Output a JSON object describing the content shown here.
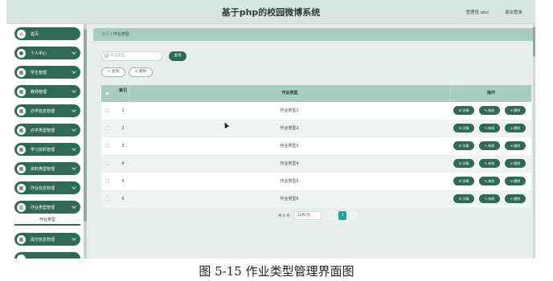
{
  "header": {
    "title": "基于php的校园微博系统",
    "user": "管理员 abo",
    "logout": "退出登录"
  },
  "sidebar": {
    "items": [
      {
        "label": "首页",
        "icon": "home-icon",
        "glyph": "⌂"
      },
      {
        "label": "个人中心",
        "icon": "person-icon",
        "glyph": "●"
      },
      {
        "label": "学生管理",
        "icon": "grid-icon",
        "glyph": "▦"
      },
      {
        "label": "教师管理",
        "icon": "grid-icon",
        "glyph": "▦"
      },
      {
        "label": "办学信息管理",
        "icon": "grid-icon",
        "glyph": "▦"
      },
      {
        "label": "办学类型管理",
        "icon": "grid-icon",
        "glyph": "▦"
      },
      {
        "label": "学习资料管理",
        "icon": "grid-icon",
        "glyph": "▦"
      },
      {
        "label": "资料类型管理",
        "icon": "grid-icon",
        "glyph": "▦"
      },
      {
        "label": "作业信息管理",
        "icon": "grid-icon",
        "glyph": "▦"
      },
      {
        "label": "作业类型管理",
        "icon": "chart-icon",
        "glyph": "▥"
      },
      {
        "label": "提交信息管理",
        "icon": "grid-icon",
        "glyph": "▦"
      }
    ],
    "active_sub": "作业类型"
  },
  "breadcrumb": {
    "home": "首页",
    "sep": "/",
    "current": "作业类型"
  },
  "search": {
    "placeholder": "作业类型",
    "button": "查询"
  },
  "actions": {
    "add": "+ 新增",
    "delete": "⊝ 删除"
  },
  "table": {
    "headers": {
      "no": "索引",
      "type": "作业类型",
      "ops": "操作"
    },
    "rows": [
      {
        "no": "1",
        "type": "作业类型1"
      },
      {
        "no": "2",
        "type": "作业类型2"
      },
      {
        "no": "3",
        "type": "作业类型3"
      },
      {
        "no": "4",
        "type": "作业类型4"
      },
      {
        "no": "5",
        "type": "作业类型5"
      },
      {
        "no": "6",
        "type": "作业类型6"
      }
    ],
    "row_actions": {
      "detail": "☰ 详情",
      "edit": "✎ 修改",
      "delete": "⊝ 删除"
    }
  },
  "pager": {
    "total": "共 6 条",
    "size": "10条/页",
    "page": "1",
    "prev": "‹",
    "next": "›"
  },
  "caption": "图 5-15 作业类型管理界面图"
}
